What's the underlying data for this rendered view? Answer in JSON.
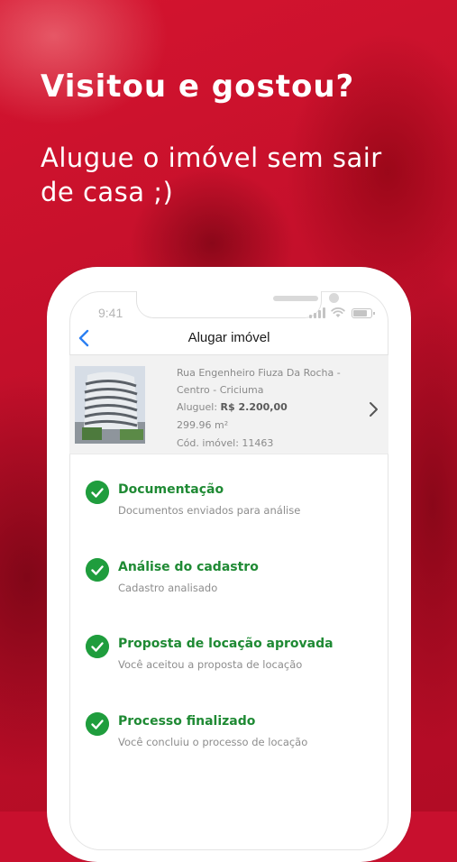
{
  "promo": {
    "headline": "Visitou e gostou?",
    "subheadline": "Alugue o imóvel sem sair de casa ;)"
  },
  "colors": {
    "brand_red": "#c8102e",
    "success_green": "#1f8a34",
    "check_green": "#1f9d3d",
    "ios_blue": "#2b7ff2"
  },
  "status_bar": {
    "time": "9:41",
    "icons": [
      "signal-icon",
      "wifi-icon",
      "battery-icon"
    ]
  },
  "nav": {
    "back_icon": "chevron-left-icon",
    "title": "Alugar imóvel"
  },
  "property": {
    "address": "Rua Engenheiro Fiuza Da Rocha - Centro - Criciuma",
    "rent_label": "Aluguel:",
    "rent_value": "R$ 2.200,00",
    "area": "299.96 m²",
    "code": "Cód. imóvel: 11463",
    "open_icon": "chevron-right-icon"
  },
  "steps": [
    {
      "title": "Documentação",
      "description": "Documentos enviados para análise",
      "icon": "check-icon"
    },
    {
      "title": "Análise do cadastro",
      "description": "Cadastro analisado",
      "icon": "check-icon"
    },
    {
      "title": "Proposta de locação aprovada",
      "description": "Você aceitou a proposta de locação",
      "icon": "check-icon"
    },
    {
      "title": "Processo finalizado",
      "description": "Você concluiu o processo de locação",
      "icon": "check-icon"
    }
  ]
}
